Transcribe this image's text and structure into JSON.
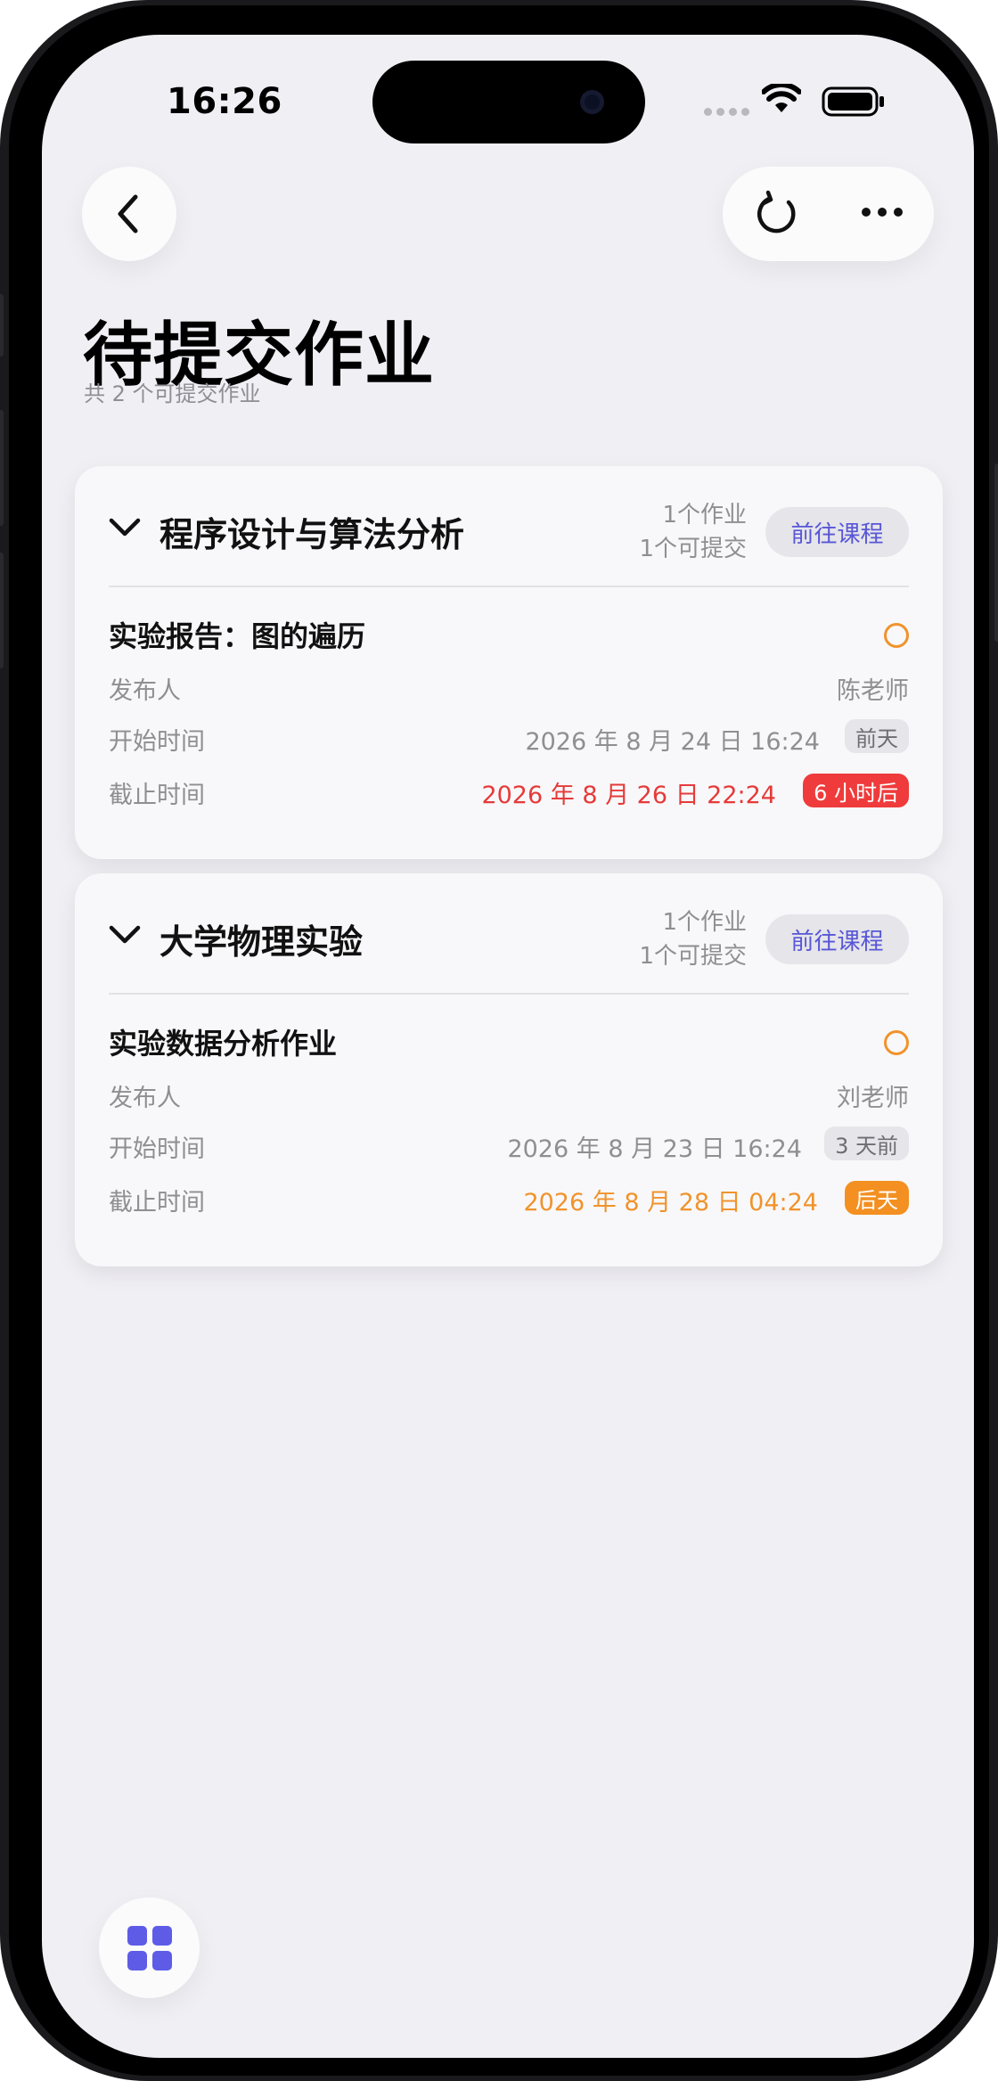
{
  "status_bar": {
    "time": "16:26"
  },
  "header": {
    "title": "待提交作业",
    "subtitle": "共 2 个可提交作业"
  },
  "courses": [
    {
      "name": "程序设计与算法分析",
      "count_assignments": "1个作业",
      "count_submittable": "1个可提交",
      "goto_label": "前往课程",
      "assignment": {
        "title": "实验报告：图的遍历",
        "publisher_label": "发布人",
        "publisher": "陈老师",
        "start_label": "开始时间",
        "start_time": "2026 年 8 月 24 日 16:24",
        "start_tag": "前天",
        "due_label": "截止时间",
        "due_time": "2026 年 8 月 26 日 22:24",
        "due_tag": "6 小时后",
        "due_color": "#e63a3a"
      }
    },
    {
      "name": "大学物理实验",
      "count_assignments": "1个作业",
      "count_submittable": "1个可提交",
      "goto_label": "前往课程",
      "assignment": {
        "title": "实验数据分析作业",
        "publisher_label": "发布人",
        "publisher": "刘老师",
        "start_label": "开始时间",
        "start_time": "2026 年 8 月 23 日 16:24",
        "start_tag": "3 天前",
        "due_label": "截止时间",
        "due_time": "2026 年 8 月 28 日 04:24",
        "due_tag": "后天",
        "due_color": "#f0932b"
      }
    }
  ],
  "icons": {
    "back": "chevron-left-icon",
    "refresh": "refresh-icon",
    "more": "more-horizontal-icon",
    "collapse": "chevron-down-icon",
    "status": "circle-icon",
    "apps": "grid-icon"
  },
  "colors": {
    "accent": "#5e5ce6",
    "urgent": "#ef3b3b",
    "warning": "#f39021",
    "background": "#f0eff4"
  }
}
